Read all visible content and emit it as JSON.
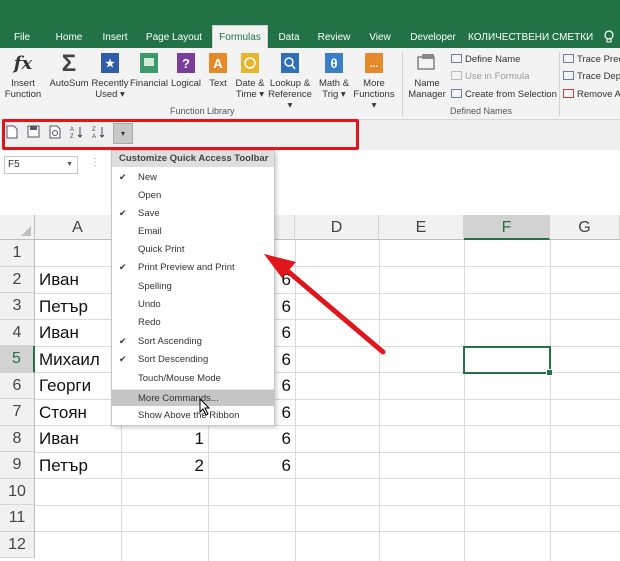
{
  "tabs": [
    {
      "label": "File"
    },
    {
      "label": "Home"
    },
    {
      "label": "Insert"
    },
    {
      "label": "Page Layout"
    },
    {
      "label": "Formulas"
    },
    {
      "label": "Data"
    },
    {
      "label": "Review"
    },
    {
      "label": "View"
    },
    {
      "label": "Developer"
    },
    {
      "label": "КОЛИЧЕСТВЕНИ СМЕТКИ"
    }
  ],
  "ribbon": {
    "function_library": {
      "label": "Function Library",
      "insert_function": {
        "l1": "Insert",
        "l2": "Function",
        "icon": "fx"
      },
      "autosum": {
        "l1": "AutoSum",
        "l2": "",
        "icon": "Σ"
      },
      "recently_used": {
        "l1": "Recently",
        "l2": "Used ▾"
      },
      "financial": {
        "l1": "Financial",
        "l2": ""
      },
      "logical": {
        "l1": "Logical",
        "l2": ""
      },
      "text": {
        "l1": "Text",
        "l2": ""
      },
      "date_time": {
        "l1": "Date &",
        "l2": "Time ▾"
      },
      "lookup": {
        "l1": "Lookup &",
        "l2": "Reference ▾"
      },
      "math": {
        "l1": "Math &",
        "l2": "Trig ▾"
      },
      "more": {
        "l1": "More",
        "l2": "Functions ▾"
      }
    },
    "defined_names": {
      "label": "Defined Names",
      "name_manager": {
        "l1": "Name",
        "l2": "Manager"
      },
      "define_name": "Define Name",
      "use_in_formula": "Use in Formula",
      "create_from_selection": "Create from Selection"
    },
    "auditing": {
      "trace_precedents": "Trace Prec",
      "trace_dependents": "Trace Dep",
      "remove_arrows": "Remove A"
    }
  },
  "qat": {
    "dropdown": "▾"
  },
  "name_box": "F5",
  "formula_dots": "⋮",
  "columns": [
    "A",
    "B",
    "C",
    "D",
    "E",
    "F",
    "G"
  ],
  "rows": [
    "1",
    "2",
    "3",
    "4",
    "5",
    "6",
    "7",
    "8",
    "9",
    "10",
    "11",
    "12"
  ],
  "cells": {
    "a": [
      "",
      "Иван",
      "Петър",
      "Иван",
      "Михаил",
      "Георги",
      "Стоян",
      "Иван",
      "Петър"
    ],
    "b": [
      "1",
      "2"
    ],
    "c": [
      "6",
      "6",
      "6",
      "6",
      "6",
      "6",
      "6",
      "6"
    ]
  },
  "menu": {
    "title": "Customize Quick Access Toolbar",
    "items": [
      {
        "label": "New",
        "checked": true
      },
      {
        "label": "Open",
        "checked": false
      },
      {
        "label": "Save",
        "checked": true
      },
      {
        "label": "Email",
        "checked": false
      },
      {
        "label": "Quick Print",
        "checked": false
      },
      {
        "label": "Print Preview and Print",
        "checked": true
      },
      {
        "label": "Spelling",
        "checked": false
      },
      {
        "label": "Undo",
        "checked": false
      },
      {
        "label": "Redo",
        "checked": false
      },
      {
        "label": "Sort Ascending",
        "checked": true
      },
      {
        "label": "Sort Descending",
        "checked": true
      },
      {
        "label": "Touch/Mouse Mode",
        "checked": false
      },
      {
        "label": "More Commands...",
        "checked": false
      },
      {
        "label": "Show Above the Ribbon",
        "checked": false
      }
    ],
    "check_glyph": "✔"
  },
  "colors": {
    "excel_green": "#217346",
    "annotation_red": "#e0161b"
  }
}
